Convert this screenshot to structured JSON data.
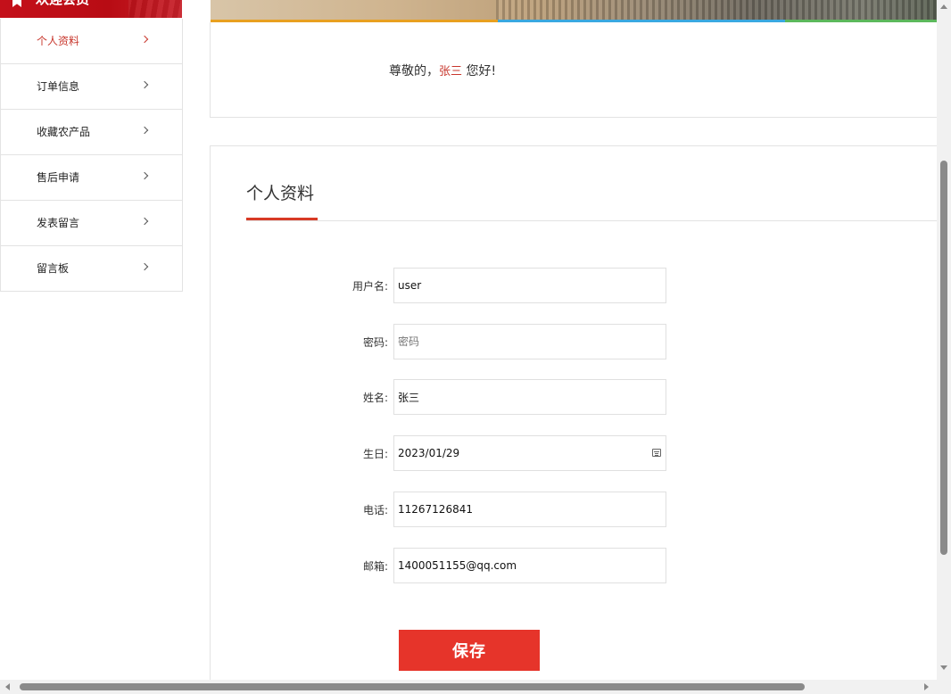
{
  "sidebar": {
    "header_title": "欢迎会员",
    "items": [
      {
        "label": "个人资料",
        "active": true
      },
      {
        "label": "订单信息",
        "active": false
      },
      {
        "label": "收藏农产品",
        "active": false
      },
      {
        "label": "售后申请",
        "active": false
      },
      {
        "label": "发表留言",
        "active": false
      },
      {
        "label": "留言板",
        "active": false
      }
    ]
  },
  "banner": {
    "accent_colors": [
      "#e8a020",
      "#3aa8e0",
      "#5cb85c"
    ]
  },
  "greeting": {
    "prefix": "尊敬的，",
    "name": "张三",
    "suffix": " 您好!"
  },
  "profile": {
    "title": "个人资料",
    "fields": [
      {
        "label": "用户名:",
        "value": "user",
        "placeholder": ""
      },
      {
        "label": "密码:",
        "value": "",
        "placeholder": "密码"
      },
      {
        "label": "姓名:",
        "value": "张三",
        "placeholder": ""
      },
      {
        "label": "生日:",
        "value": "2023/01/29",
        "placeholder": ""
      },
      {
        "label": "电话:",
        "value": "11267126841",
        "placeholder": ""
      },
      {
        "label": "邮箱:",
        "value": "1400051155@qq.com",
        "placeholder": ""
      }
    ],
    "save_label": "保存"
  },
  "colors": {
    "accent": "#c8372d",
    "button": "#e6342a",
    "sidebar_header": "#c4101a"
  }
}
